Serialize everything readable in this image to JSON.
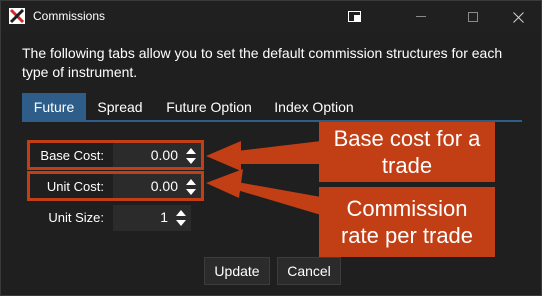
{
  "window": {
    "title": "Commissions"
  },
  "intro_text": "The following tabs allow you to set the default commission structures for each type of instrument.",
  "tabs": [
    {
      "label": "Future",
      "active": true
    },
    {
      "label": "Spread",
      "active": false
    },
    {
      "label": "Future Option",
      "active": false
    },
    {
      "label": "Index Option",
      "active": false
    }
  ],
  "fields": {
    "base_cost": {
      "label": "Base Cost:",
      "value": "0.00"
    },
    "unit_cost": {
      "label": "Unit Cost:",
      "value": "0.00"
    },
    "unit_size": {
      "label": "Unit Size:",
      "value": "1"
    }
  },
  "callouts": {
    "base_cost_note": "Base cost for a trade",
    "commission_note": "Commission rate per trade"
  },
  "buttons": {
    "update": "Update",
    "cancel": "Cancel"
  },
  "colors": {
    "accent_tab": "#2e5d8a",
    "annotation": "#c23e14",
    "background": "#1f1f1f"
  }
}
